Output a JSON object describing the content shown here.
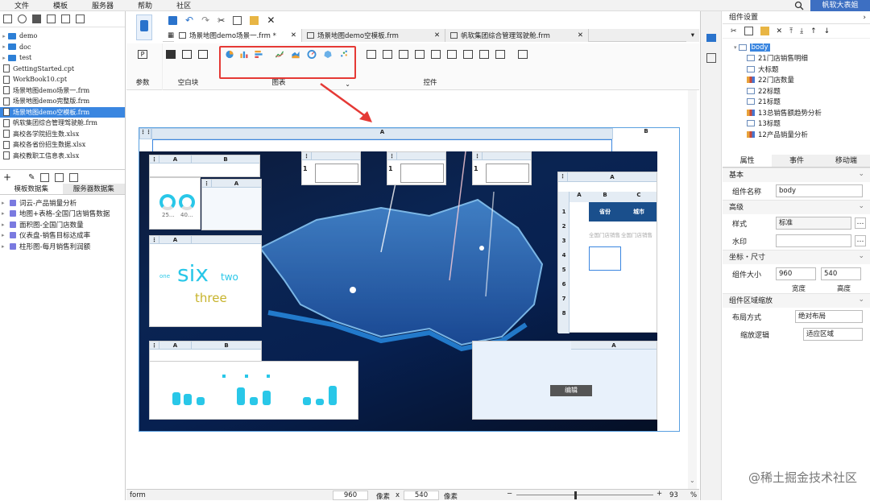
{
  "menu": [
    "文件",
    "模板",
    "服务器",
    "帮助",
    "社区"
  ],
  "user_button": "帆软大表姐",
  "file_tree": [
    {
      "type": "folder",
      "name": "demo"
    },
    {
      "type": "folder",
      "name": "doc"
    },
    {
      "type": "folder",
      "name": "test"
    },
    {
      "type": "file",
      "name": "GettingStarted.cpt"
    },
    {
      "type": "file",
      "name": "WorkBook10.cpt"
    },
    {
      "type": "file",
      "name": "场景地图demo场景一.frm"
    },
    {
      "type": "file",
      "name": "场景地图demo完整版.frm"
    },
    {
      "type": "file",
      "name": "场景地图demo空模板.frm",
      "selected": true
    },
    {
      "type": "file",
      "name": "帆软集团综合管理驾驶舱.frm"
    },
    {
      "type": "file",
      "name": "高校各学院招生数.xlsx"
    },
    {
      "type": "file",
      "name": "高校各省份招生数据.xlsx"
    },
    {
      "type": "file",
      "name": "高校教职工信息表.xlsx"
    }
  ],
  "dataset_tabs": [
    "模板数据集",
    "服务器数据集"
  ],
  "datasets": [
    "词云-产品销量分析",
    "地图+表格-全国门店销售数据",
    "面积图-全国门店数量",
    "仪表盘-销售目标达成率",
    "柱形图-每月销售利润额"
  ],
  "editor_tabs": [
    "场景地图demo场景一.frm *",
    "场景地图demo空模板.frm",
    "帆软集团综合管理驾驶舱.frm"
  ],
  "ribbon_groups": {
    "params": "参数",
    "blank": "空白块",
    "chart": "图表",
    "controls": "控件"
  },
  "canvas": {
    "col_a": "A",
    "col_b": "B"
  },
  "word_cloud": {
    "w1": "one",
    "w2": "six",
    "w3": "two",
    "w4": "three"
  },
  "gauge_labels": [
    "25...",
    "40..."
  ],
  "table": {
    "col_a": "A",
    "col_b": "B",
    "col_c": "C",
    "h1": "省份",
    "h2": "城市",
    "r1a": "全国门店销售",
    "r1b": "全国门店销售"
  },
  "edit_button": "编辑",
  "right_title": "组件设置",
  "components": [
    "body",
    "21门店销售明细",
    "大标题",
    "22门店数量",
    "22标题",
    "21标题",
    "13总销售额趋势分析",
    "13标题",
    "12产品销量分析"
  ],
  "prop_tabs": [
    "属性",
    "事件",
    "移动端"
  ],
  "props": {
    "basic": "基本",
    "name_label": "组件名称",
    "name_value": "body",
    "advanced": "高级",
    "style_label": "样式",
    "style_value": "标准",
    "watermark_label": "水印",
    "coord": "坐标・尺寸",
    "size_label": "组件大小",
    "width": "960",
    "height": "540",
    "width_label": "宽度",
    "height_label": "高度",
    "scale": "组件区域缩放",
    "layout_label": "布局方式",
    "layout_value": "绝对布局",
    "scale_label": "缩放逻辑",
    "scale_value": "适应区域"
  },
  "status": {
    "mode": "form",
    "w": "960",
    "unit1": "像素",
    "x": "x",
    "h": "540",
    "unit2": "像素",
    "zoom": "93",
    "pct": "%"
  },
  "watermark": "@稀土掘金技术社区"
}
